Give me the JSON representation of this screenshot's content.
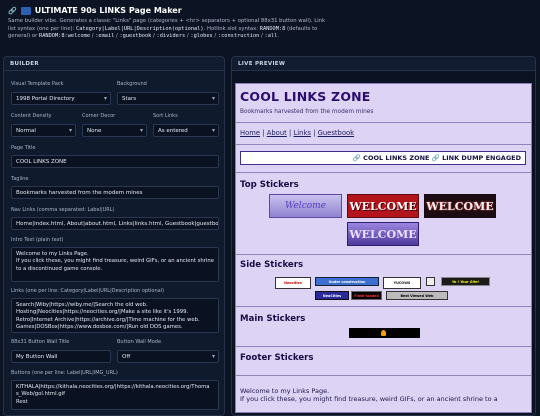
{
  "header": {
    "title": "ULTIMATE 90s LINKS Page Maker",
    "description_1": "Same builder vibe. Generates a classic \"Links\" page (categories + <hr> separators + optional 88x31 button wall). Link",
    "description_2a": "list syntax (one per line): ",
    "description_2b": "Category|Label|URL|Description(optional)",
    "description_2c": ". Hotlink slot syntax: ",
    "description_2d": "RANDOM:8",
    "description_2e": " (defaults to",
    "description_3a": "general) or ",
    "description_3b": "RANDOM:8:welcome",
    "description_3c": " / ",
    "description_3d": ":email",
    "description_3e": " / ",
    "description_3f": ":guestbook",
    "description_3g": " / ",
    "description_3h": ":dividers",
    "description_3i": " / ",
    "description_3j": ":globes",
    "description_3k": " / ",
    "description_3l": ":construction",
    "description_3m": " / ",
    "description_3n": ":all",
    "description_3o": "."
  },
  "builder": {
    "heading": "BUILDER",
    "template_pack_label": "Visual Template Pack",
    "template_pack_value": "1998 Portal Directory",
    "background_label": "Background",
    "background_value": "Stars",
    "density_label": "Content Density",
    "density_value": "Normal",
    "corner_label": "Corner Decor",
    "corner_value": "None",
    "sort_label": "Sort Links",
    "sort_value": "As entered",
    "page_title_label": "Page Title",
    "page_title_value": "COOL LINKS ZONE",
    "tagline_label": "Tagline",
    "tagline_value": "Bookmarks harvested from the modem mines",
    "nav_label": "Nav Links (comma separated: Label|URL)",
    "nav_value": "Home|index.html, About|about.html, Links|links.html, Guestbook|guestbo",
    "intro_label": "Intro Text (plain text)",
    "intro_lines": [
      "Welcome to my Links Page.",
      "If you click these, you might find treasure, weird GIFs, or an ancient shrine",
      "to a discontinued game console."
    ],
    "links_label": "Links (one per line: Category|Label|URL|Description optional)",
    "links_lines": [
      "Search|Wiby|https://wiby.me/|Search the old web.",
      "Hosting|Neocities|https://neocities.org/|Make a site like it's 1999.",
      "Retro|Internet Archive|https://archive.org/|Time machine for the web.",
      "Games|DOSBox|https://www.dosbox.com/|Run old DOS games."
    ],
    "wall_title_label": "88x31 Button Wall Title",
    "wall_title_value": "My Button Wall",
    "wall_mode_label": "Button Wall Mode",
    "wall_mode_value": "Off",
    "buttons_label": "Buttons (one per line: Label|URL|IMG_URL)",
    "buttons_lines": [
      "KITHALA|https://kithala.neocities.org/|https://kithala.neocities.org/Thoma",
      "s_Web/gol.html.gif",
      "Rest"
    ]
  },
  "preview": {
    "heading": "LIVE PREVIEW",
    "title": "COOL LINKS ZONE",
    "tagline": "Bookmarks harvested from the modem mines",
    "nav": [
      "Home",
      "About",
      "Links",
      "Guestbook"
    ],
    "nav_sep": "|",
    "dump_text": "🔗 COOL LINKS ZONE 🔗 LINK DUMP ENGAGED",
    "top_stickers_heading": "Top Stickers",
    "top_stickers": [
      "Welcome",
      "WELCOME",
      "WELCOME",
      "WELCOME"
    ],
    "side_stickers_heading": "Side Stickers",
    "side_stickers": [
      "Neocities",
      "Under construction",
      "YUCOWS",
      "",
      "Yo ! Your Site!",
      "NeoCities",
      "Flash-loaded",
      "Best Viewed Web"
    ],
    "main_stickers_heading": "Main Stickers",
    "footer_stickers_heading": "Footer Stickers",
    "intro_lines": [
      "Welcome to my Links Page.",
      "If you click these, you might find treasure, weird GIFs, or an ancient shrine to a"
    ]
  },
  "colors": {
    "page_bg": "#0c1424",
    "preview_page_bg": "#dcd3f5",
    "preview_title": "#2a0e6e",
    "sticker_red": "#b4151c",
    "sticker_purple": "#6d55b8"
  }
}
